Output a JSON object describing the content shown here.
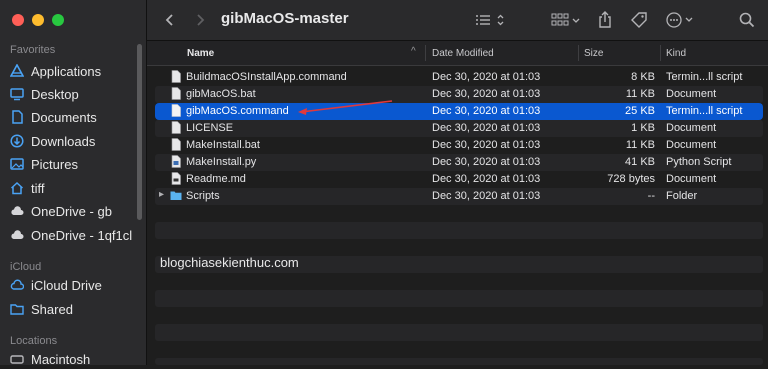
{
  "window": {
    "title": "gibMacOS-master"
  },
  "sidebar": {
    "favorites_label": "Favorites",
    "favorites": [
      {
        "label": "Applications",
        "icon": "applications-icon"
      },
      {
        "label": "Desktop",
        "icon": "desktop-icon"
      },
      {
        "label": "Documents",
        "icon": "documents-icon"
      },
      {
        "label": "Downloads",
        "icon": "downloads-icon"
      },
      {
        "label": "Pictures",
        "icon": "pictures-icon"
      },
      {
        "label": "tiff",
        "icon": "home-icon"
      },
      {
        "label": "OneDrive - gb",
        "icon": "cloud-icon"
      },
      {
        "label": "OneDrive - 1qf1cl",
        "icon": "cloud-icon"
      }
    ],
    "icloud_label": "iCloud",
    "icloud": [
      {
        "label": "iCloud Drive",
        "icon": "icloud-icon"
      },
      {
        "label": "Shared",
        "icon": "shared-folder-icon"
      }
    ],
    "locations_label": "Locations",
    "locations": [
      {
        "label": "Macintosh",
        "icon": "disk-icon"
      }
    ]
  },
  "columns": {
    "name": "Name",
    "date": "Date Modified",
    "size": "Size",
    "kind": "Kind"
  },
  "files": [
    {
      "name": "BuildmacOSInstallApp.command",
      "date": "Dec 30, 2020 at 01:03",
      "size": "8 KB",
      "kind": "Termin...ll script"
    },
    {
      "name": "gibMacOS.bat",
      "date": "Dec 30, 2020 at 01:03",
      "size": "11 KB",
      "kind": "Document"
    },
    {
      "name": "gibMacOS.command",
      "date": "Dec 30, 2020 at 01:03",
      "size": "25 KB",
      "kind": "Termin...ll script"
    },
    {
      "name": "LICENSE",
      "date": "Dec 30, 2020 at 01:03",
      "size": "1 KB",
      "kind": "Document"
    },
    {
      "name": "MakeInstall.bat",
      "date": "Dec 30, 2020 at 01:03",
      "size": "11 KB",
      "kind": "Document"
    },
    {
      "name": "MakeInstall.py",
      "date": "Dec 30, 2020 at 01:03",
      "size": "41 KB",
      "kind": "Python Script"
    },
    {
      "name": "Readme.md",
      "date": "Dec 30, 2020 at 01:03",
      "size": "728 bytes",
      "kind": "Document"
    },
    {
      "name": "Scripts",
      "date": "Dec 30, 2020 at 01:03",
      "size": "--",
      "kind": "Folder"
    }
  ],
  "watermark": "blogchiasekienthuc.com",
  "colors": {
    "selection": "#0a58d0",
    "arrow": "#e0393c",
    "folder": "#5ab3f0"
  }
}
